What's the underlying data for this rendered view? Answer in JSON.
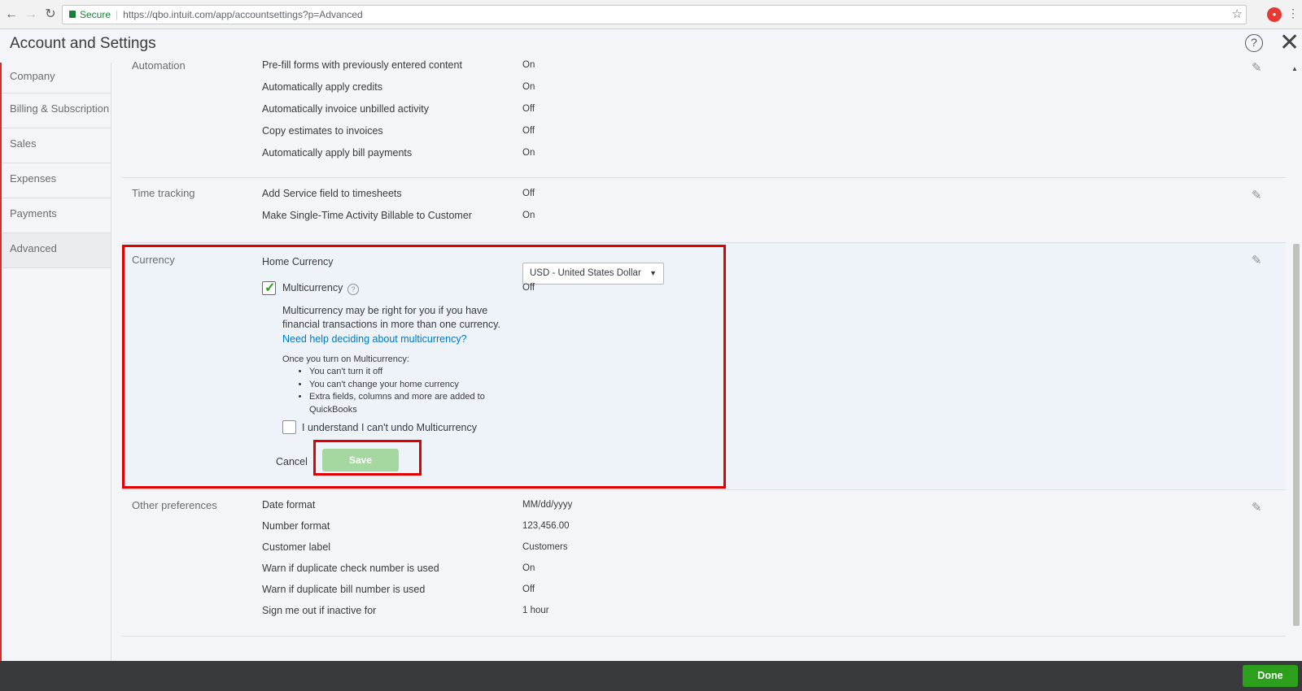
{
  "browser": {
    "secure_label": "Secure",
    "url": "https://qbo.intuit.com/app/accountsettings?p=Advanced"
  },
  "header": {
    "title": "Account and Settings"
  },
  "sidebar": {
    "items": [
      {
        "label": "Company"
      },
      {
        "label": "Billing & Subscription"
      },
      {
        "label": "Sales"
      },
      {
        "label": "Expenses"
      },
      {
        "label": "Payments"
      },
      {
        "label": "Advanced"
      }
    ]
  },
  "automation": {
    "label": "Automation",
    "rows": [
      {
        "label": "Pre-fill forms with previously entered content",
        "value": "On"
      },
      {
        "label": "Automatically apply credits",
        "value": "On"
      },
      {
        "label": "Automatically invoice unbilled activity",
        "value": "Off"
      },
      {
        "label": "Copy estimates to invoices",
        "value": "Off"
      },
      {
        "label": "Automatically apply bill payments",
        "value": "On"
      }
    ]
  },
  "time_tracking": {
    "label": "Time tracking",
    "rows": [
      {
        "label": "Add Service field to timesheets",
        "value": "Off"
      },
      {
        "label": "Make Single-Time Activity Billable to Customer",
        "value": "On"
      }
    ]
  },
  "currency": {
    "label": "Currency",
    "home_currency_label": "Home Currency",
    "home_currency_value": "USD - United States Dollar",
    "multicurrency_label": "Multicurrency",
    "multicurrency_value": "Off",
    "description": "Multicurrency may be right for you if you have financial transactions in more than one currency.",
    "help_link": "Need help deciding about multicurrency?",
    "once_text": "Once you turn on Multicurrency:",
    "bullets": [
      "You can't turn it off",
      "You can't change your home currency",
      "Extra fields, columns and more are added to QuickBooks"
    ],
    "understand_label": "I understand I can't undo Multicurrency",
    "cancel_label": "Cancel",
    "save_label": "Save"
  },
  "other_preferences": {
    "label": "Other preferences",
    "rows": [
      {
        "label": "Date format",
        "value": "MM/dd/yyyy"
      },
      {
        "label": "Number format",
        "value": "123,456.00"
      },
      {
        "label": "Customer label",
        "value": "Customers"
      },
      {
        "label": "Warn if duplicate check number is used",
        "value": "On"
      },
      {
        "label": "Warn if duplicate bill number is used",
        "value": "Off"
      },
      {
        "label": "Sign me out if inactive for",
        "value": "1 hour"
      }
    ]
  },
  "footer": {
    "done_label": "Done"
  },
  "colors": {
    "accent_green": "#2ca01c",
    "link_blue": "#0077c5",
    "highlight_red": "#e00000"
  },
  "icons": {
    "back": "back-arrow-icon",
    "forward": "forward-arrow-icon",
    "reload": "reload-icon",
    "lock": "lock-icon",
    "bookmark": "star-icon",
    "help": "help-icon",
    "close": "close-icon",
    "edit": "pencil-icon"
  }
}
